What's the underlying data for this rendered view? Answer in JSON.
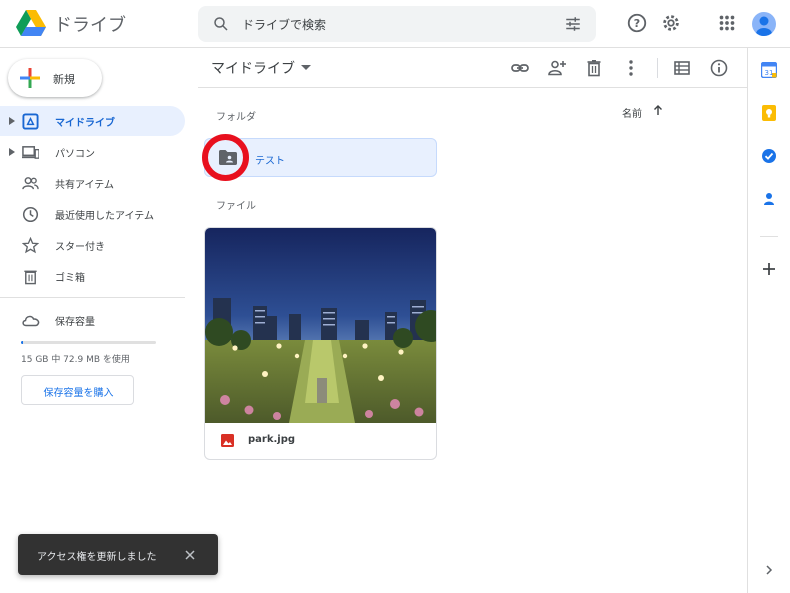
{
  "header": {
    "app_title": "ドライブ",
    "search_placeholder": "ドライブで検索",
    "icons": [
      "drive-logo",
      "search-icon",
      "tune-icon",
      "help-icon",
      "settings-icon",
      "apps-icon",
      "account-avatar"
    ]
  },
  "sidebar": {
    "new_label": "新規",
    "items": [
      {
        "label": "マイドライブ",
        "icon": "my-drive-icon",
        "active": true,
        "expandable": true
      },
      {
        "label": "パソコン",
        "icon": "computers-icon",
        "active": false,
        "expandable": true
      },
      {
        "label": "共有アイテム",
        "icon": "shared-icon",
        "active": false,
        "expandable": false
      },
      {
        "label": "最近使用したアイテム",
        "icon": "recent-icon",
        "active": false,
        "expandable": false
      },
      {
        "label": "スター付き",
        "icon": "star-icon",
        "active": false,
        "expandable": false
      },
      {
        "label": "ゴミ箱",
        "icon": "trash-icon",
        "active": false,
        "expandable": false
      }
    ],
    "storage": {
      "label": "保存容量",
      "usage_text": "15 GB 中 72.9 MB を使用",
      "used_fraction": 0.005,
      "buy_label": "保存容量を購入"
    }
  },
  "main": {
    "title": "マイドライブ",
    "toolbar_icons": [
      "link-icon",
      "share-icon",
      "trash-icon",
      "more-icon",
      "list-view-icon",
      "info-icon"
    ],
    "folders_label": "フォルダ",
    "files_label": "ファイル",
    "sort_label": "名前",
    "folders": [
      {
        "name": "テスト",
        "icon": "shared-folder-icon",
        "selected": true
      }
    ],
    "files": [
      {
        "name": "park.jpg",
        "icon": "image-file-icon"
      }
    ]
  },
  "right_panel": {
    "icons": [
      "calendar-icon",
      "keep-icon",
      "tasks-icon",
      "contacts-icon",
      "add-icon",
      "expand-icon"
    ]
  },
  "snackbar": {
    "text": "アクセス権を更新しました",
    "close_icon": "close-icon"
  },
  "colors": {
    "accent": "#1a73e8",
    "active_bg": "#e8f0fe",
    "highlight_ring": "#e8101e",
    "snackbar_bg": "#323232"
  }
}
